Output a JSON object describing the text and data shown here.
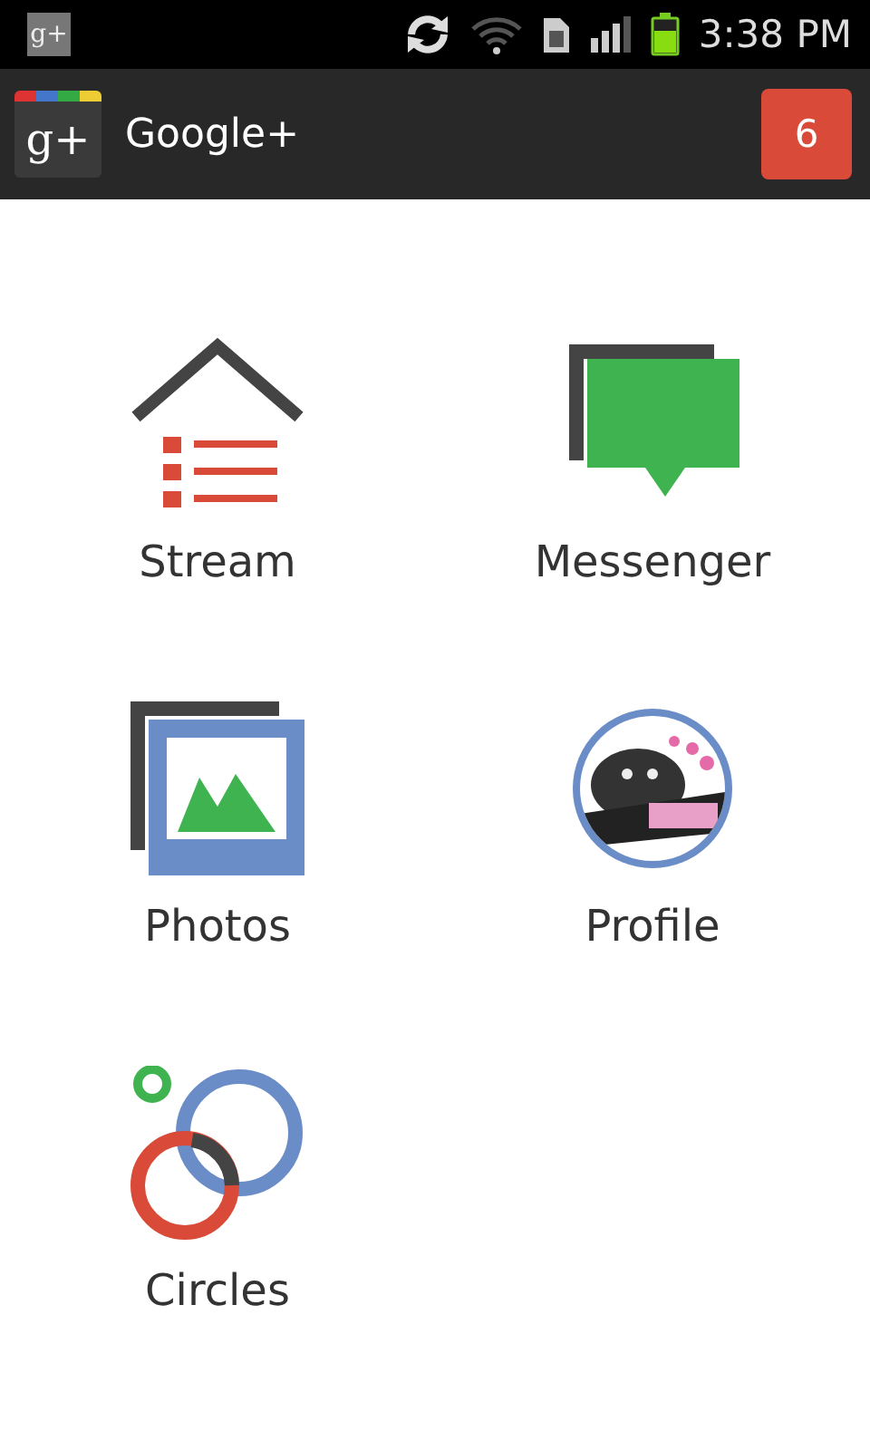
{
  "status_bar": {
    "notification_icon_text": "g+",
    "time": "3:38 PM"
  },
  "action_bar": {
    "logo_text": "g+",
    "title": "Google+",
    "notification_count": "6"
  },
  "tiles": [
    {
      "kind": "stream",
      "label": "Stream"
    },
    {
      "kind": "messenger",
      "label": "Messenger"
    },
    {
      "kind": "photos",
      "label": "Photos"
    },
    {
      "kind": "profile",
      "label": "Profile"
    },
    {
      "kind": "circles",
      "label": "Circles"
    }
  ]
}
